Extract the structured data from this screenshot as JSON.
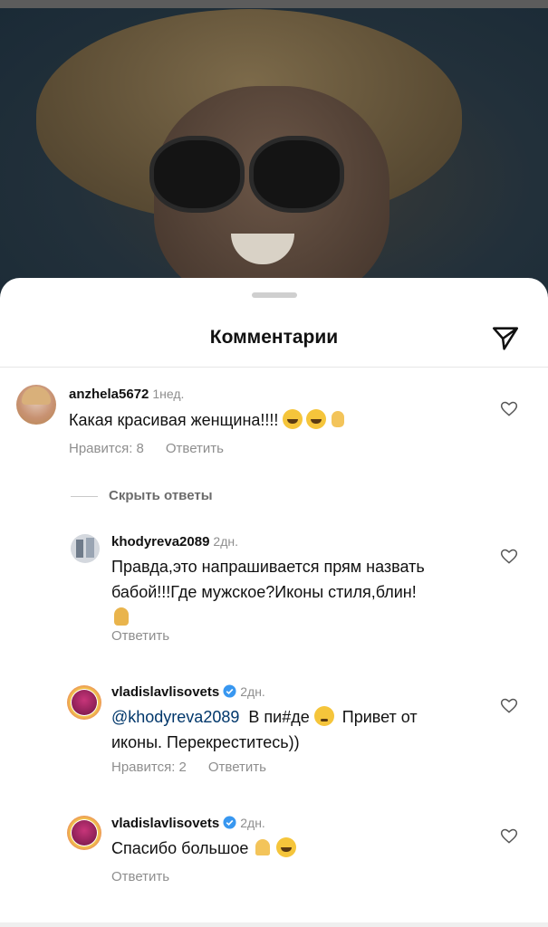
{
  "sheet": {
    "title": "Комментарии"
  },
  "comments": [
    {
      "username": "anzhela5672",
      "time": "1нед.",
      "text": "Какая красивая женщина!!!!",
      "likes_label": "Нравится: 8",
      "reply_label": "Ответить"
    }
  ],
  "hide_replies_label": "Скрыть ответы",
  "replies": [
    {
      "username": "khodyreva2089",
      "time": "2дн.",
      "text_line1": "Правда,это напрашивается прям назвать",
      "text_line2": "бабой!!!Где мужское?Иконы стиля,блин!",
      "reply_label": "Ответить"
    },
    {
      "username": "vladislavlisovets",
      "time": "2дн.",
      "verified": true,
      "mention": "@khodyreva2089",
      "text_part1": "В пи#де",
      "text_part2": "Привет от",
      "text_line2": "иконы. Перекреститесь))",
      "likes_label": "Нравится: 2",
      "reply_label": "Ответить"
    },
    {
      "username": "vladislavlisovets",
      "time": "2дн.",
      "verified": true,
      "text": "Спасибо большое",
      "reply_label": "Ответить"
    }
  ],
  "icons": {
    "share": "paper-plane-icon",
    "like": "heart-outline-icon",
    "verified": "verified-badge-icon"
  },
  "colors": {
    "verified_blue": "#3897f0",
    "mention": "#00376b",
    "meta_gray": "#8e8e8e"
  }
}
